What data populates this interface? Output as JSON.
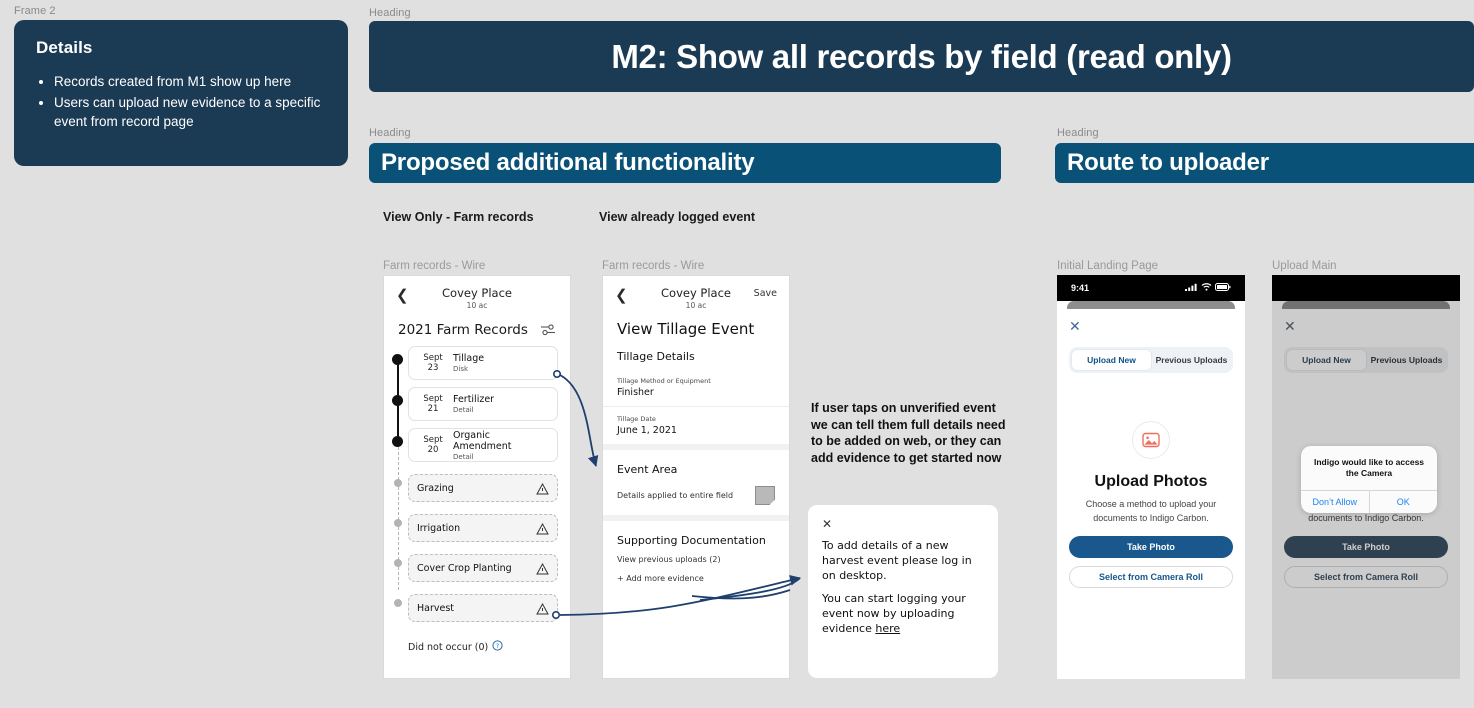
{
  "frame": {
    "label": "Frame 2"
  },
  "details": {
    "title": "Details",
    "bullets": [
      "Records created from M1 show up here",
      "Users can upload new evidence to a specific event from record page"
    ]
  },
  "headings": {
    "label": "Heading",
    "main": "M2: Show all records by field (read only)",
    "proposed": "Proposed additional functionality",
    "route": "Route to uploader"
  },
  "sections": {
    "view_only": "View Only - Farm records",
    "view_logged": "View already logged event"
  },
  "wire1": {
    "caption": "Farm records - Wire",
    "back_icon": "chevron-left-icon",
    "farm_name": "Covey Place",
    "farm_acres": "10 ac",
    "records_title": "2021 Farm Records",
    "filter_icon": "filter-sliders-icon",
    "events": [
      {
        "month": "Sept",
        "day": "23",
        "name": "Tillage",
        "sub": "Disk",
        "verified": true
      },
      {
        "month": "Sept",
        "day": "21",
        "name": "Fertilizer",
        "sub": "Detail",
        "verified": true
      },
      {
        "month": "Sept",
        "day": "20",
        "name": "Organic Amendment",
        "sub": "Detail",
        "verified": true
      }
    ],
    "unverified": [
      {
        "name": "Grazing",
        "warn_icon": "warning-triangle-icon"
      },
      {
        "name": "Irrigation",
        "warn_icon": "warning-triangle-icon"
      },
      {
        "name": "Cover Crop Planting",
        "warn_icon": "warning-triangle-icon"
      },
      {
        "name": "Harvest",
        "warn_icon": "warning-triangle-icon"
      }
    ],
    "did_not_occur": "Did not occur (0)",
    "help_icon": "question-circle-icon"
  },
  "wire2": {
    "caption": "Farm records - Wire",
    "back_icon": "chevron-left-icon",
    "farm_name": "Covey Place",
    "farm_acres": "10 ac",
    "save_label": "Save",
    "page_title": "View Tillage Event",
    "details_heading": "Tillage Details",
    "fields": [
      {
        "label": "Tillage Method or Equipment",
        "value": "Finisher"
      },
      {
        "label": "Tillage Date",
        "value": "June 1, 2021"
      }
    ],
    "event_area_heading": "Event Area",
    "event_area_text": "Details applied to entire field",
    "event_area_thumb_icon": "document-thumbnail-icon",
    "supporting_heading": "Supporting Documentation",
    "previous_uploads": "View previous uploads (2)",
    "add_more": "+  Add more evidence"
  },
  "annotation": {
    "note": "If user taps on unverified event we can tell them full details need to be added on web, or they can add evidence to get started now"
  },
  "callout": {
    "close_icon": "close-x-icon",
    "para1": "To add details of a new harvest event please log in on desktop.",
    "para2_before": "You can start logging your event now by uploading evidence ",
    "para2_link": "here"
  },
  "phone1": {
    "caption": "Initial Landing Page",
    "status_time": "9:41",
    "status_icons": [
      "cellular-signal-icon",
      "wifi-icon",
      "battery-icon"
    ],
    "close_icon": "close-x-icon",
    "tabs": [
      {
        "label": "Upload New",
        "active": true
      },
      {
        "label": "Previous Uploads",
        "active": false
      }
    ],
    "image_icon": "image-placeholder-icon",
    "title": "Upload Photos",
    "subtitle": "Choose a method to upload your documents to Indigo Carbon.",
    "primary_button": "Take Photo",
    "secondary_button": "Select from Camera Roll"
  },
  "phone2": {
    "caption": "Upload Main",
    "close_icon": "close-x-icon",
    "tabs": [
      {
        "label": "Upload New",
        "active": true
      },
      {
        "label": "Previous Uploads",
        "active": false
      }
    ],
    "subtitle": "Choose a method to upload your documents to Indigo Carbon.",
    "primary_button": "Take Photo",
    "secondary_button": "Select from Camera Roll",
    "alert": {
      "message": "Indigo would like to access the Camera",
      "deny_label": "Don’t Allow",
      "allow_label": "OK"
    }
  },
  "colors": {
    "navy": "#1b3a54",
    "teal": "#0a5177",
    "canvas": "#e0e0e0",
    "connector": "#1f3f6e",
    "ios_blue": "#1b82f5",
    "button_blue": "#19578c",
    "icon_salmon": "#ef6f5e"
  }
}
